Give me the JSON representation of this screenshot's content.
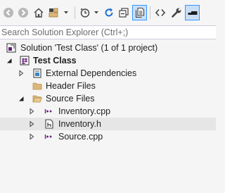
{
  "search": {
    "placeholder": "Search Solution Explorer (Ctrl+;)"
  },
  "tree": {
    "solution_label": "Solution 'Test Class' (1 of 1 project)",
    "project_label": "Test Class",
    "external_deps_label": "External Dependencies",
    "header_files_label": "Header Files",
    "source_files_label": "Source Files",
    "files": [
      "Inventory.cpp",
      "Inventory.h",
      "Source.cpp"
    ],
    "selected_file": "Inventory.h"
  },
  "toolbar": {
    "icons": [
      "back-icon",
      "forward-icon",
      "home-icon",
      "switch-views-icon",
      "pending-changes-icon",
      "sync-icon",
      "collapse-all-icon",
      "show-all-files-icon",
      "view-code-icon",
      "properties-icon",
      "preview-icon"
    ]
  },
  "colors": {
    "accent": "#3399ff",
    "selection": "#e6e6e6",
    "project_icon": "#68217a",
    "folder": "#dcb67a"
  }
}
